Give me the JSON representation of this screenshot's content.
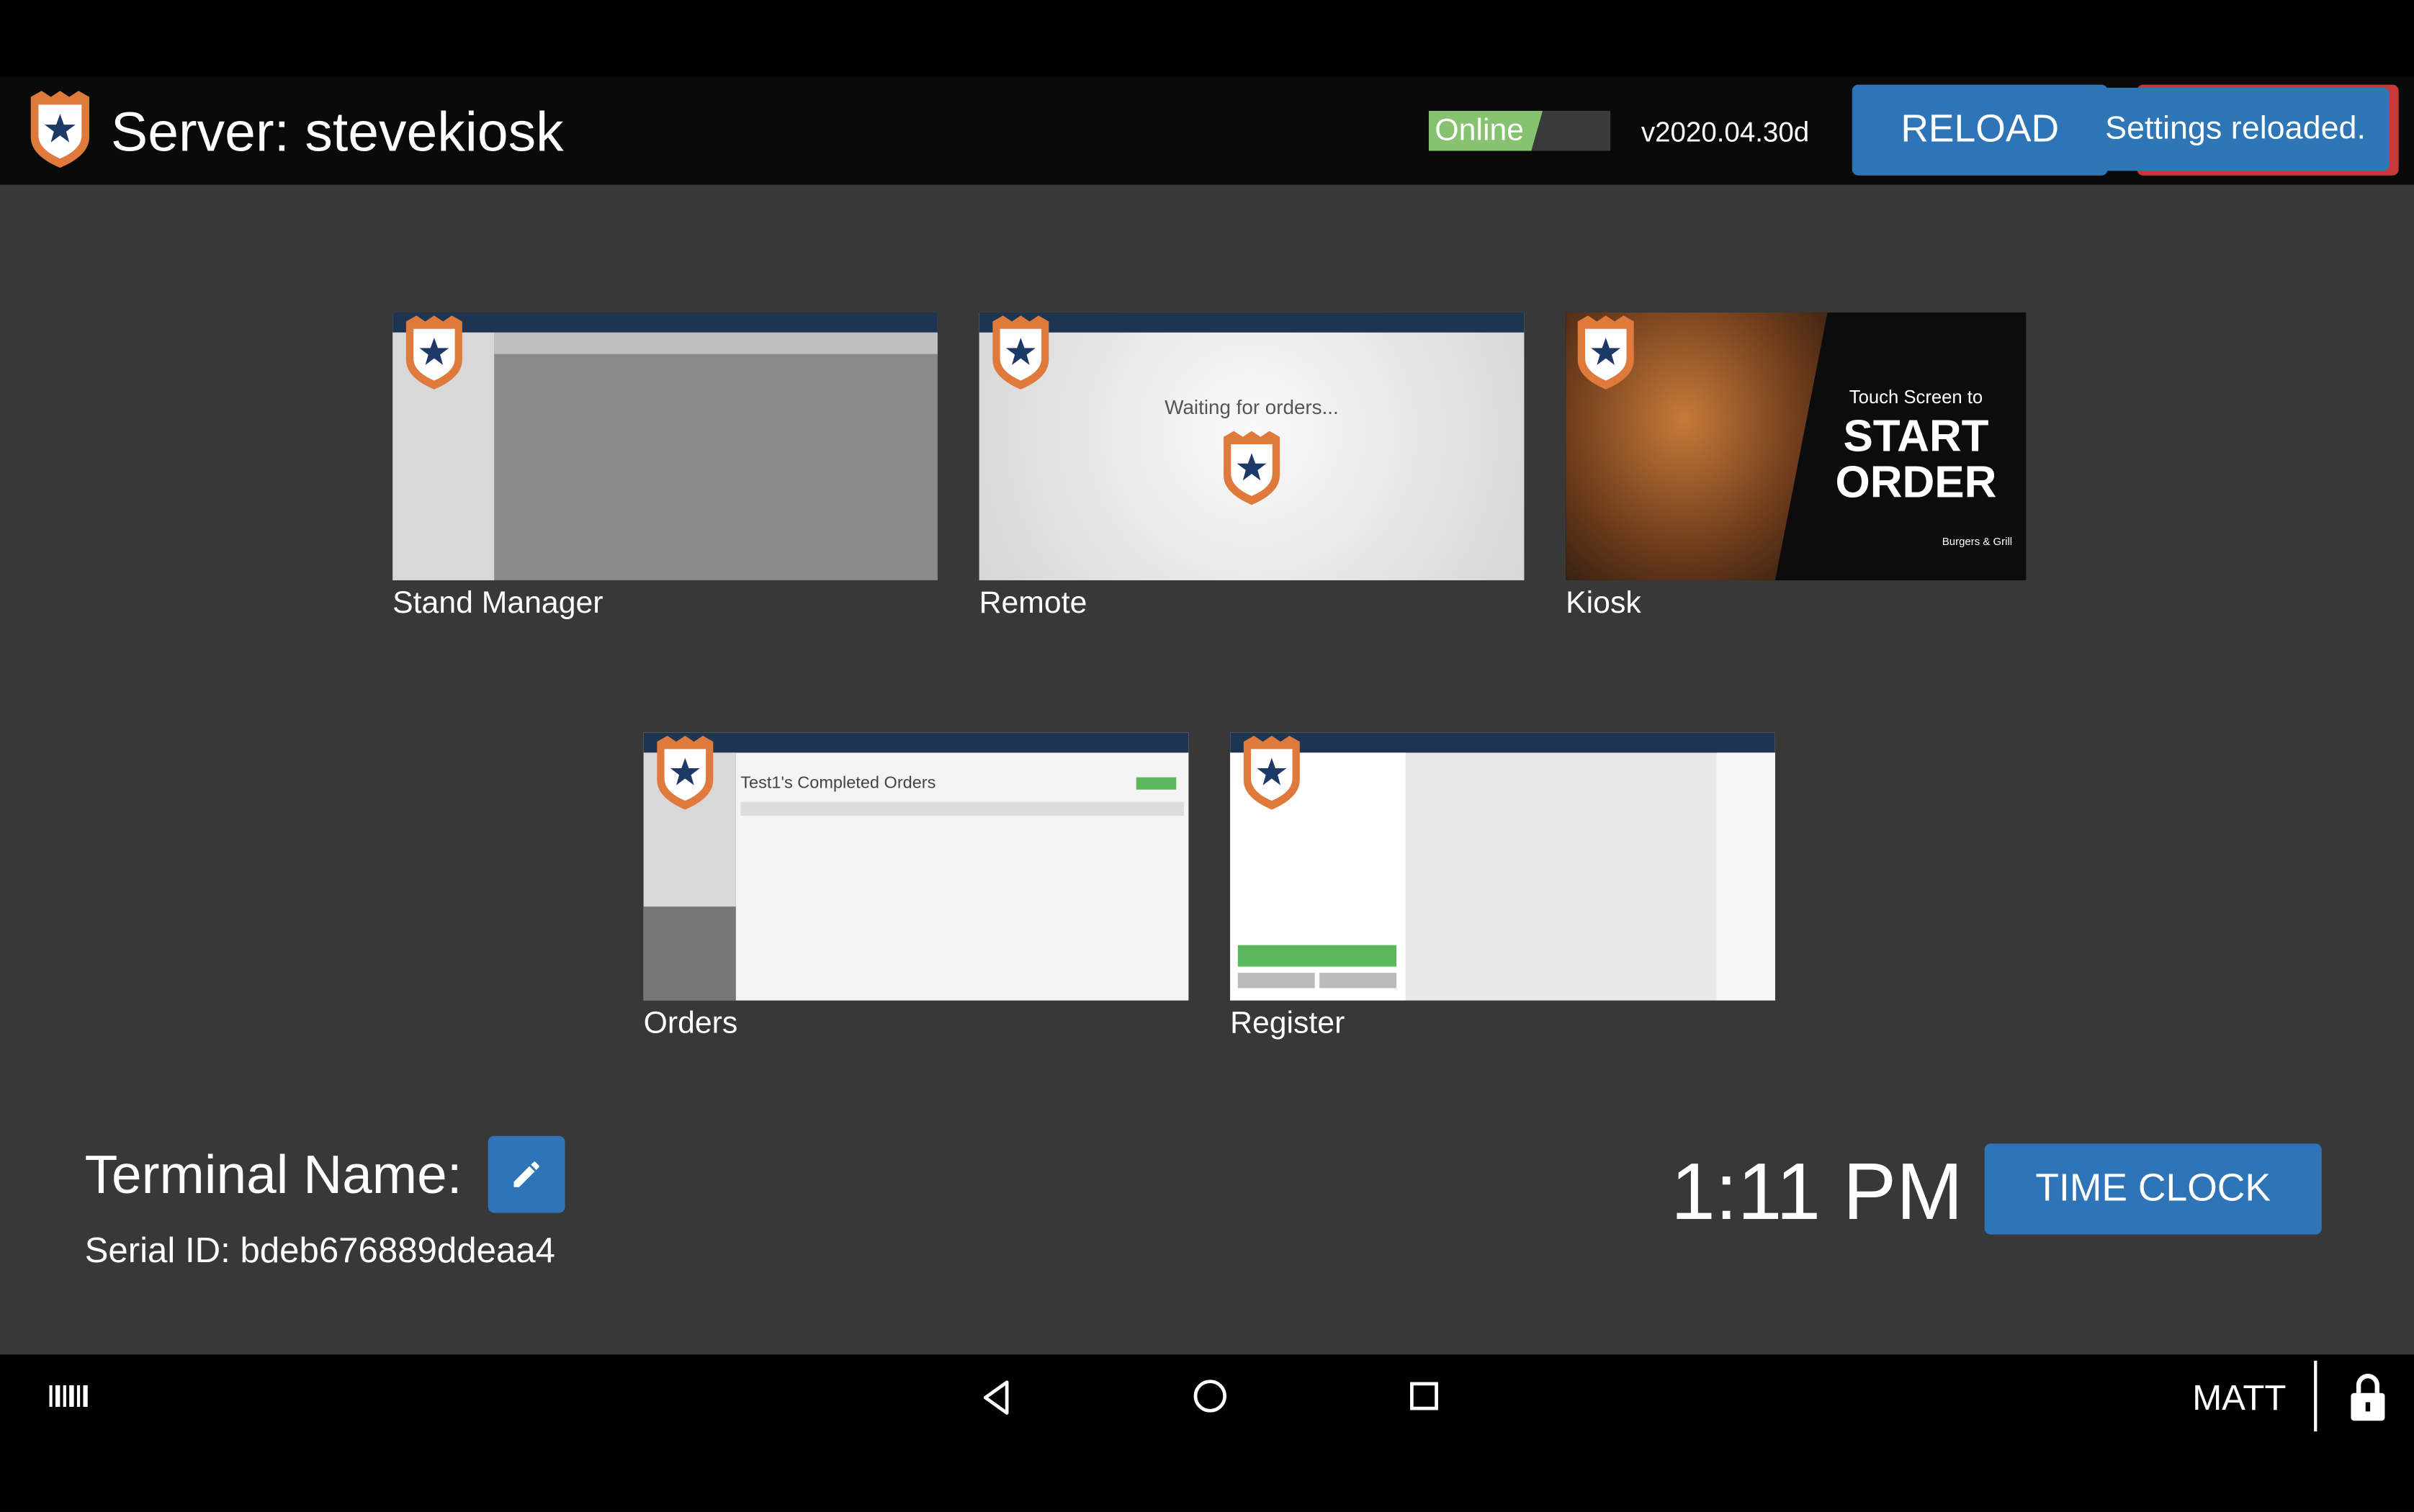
{
  "header": {
    "title": "Server: stevekiosk",
    "status": "Online",
    "version": "v2020.04.30d",
    "reload_label": "RELOAD",
    "toast": "Settings reloaded."
  },
  "apps": [
    {
      "label": "Stand Manager"
    },
    {
      "label": "Remote",
      "preview_text": "Waiting for orders..."
    },
    {
      "label": "Kiosk",
      "preview_line1": "Touch Screen to",
      "preview_line2": "START",
      "preview_line3": "ORDER",
      "preview_brand": "Burgers & Grill"
    },
    {
      "label": "Orders",
      "preview_title": "Test1's Completed Orders"
    },
    {
      "label": "Register"
    }
  ],
  "terminal": {
    "name_label": "Terminal Name:",
    "serial": "Serial ID: bdeb676889ddeaa4"
  },
  "clock": {
    "time": "1:11 PM",
    "time_clock_label": "TIME CLOCK"
  },
  "navbar": {
    "user": "MATT"
  },
  "colors": {
    "accent": "#2e74b6",
    "online": "#86c26f",
    "toast_border": "#c8383b",
    "shield": "#e07a3c",
    "background": "#383838"
  }
}
